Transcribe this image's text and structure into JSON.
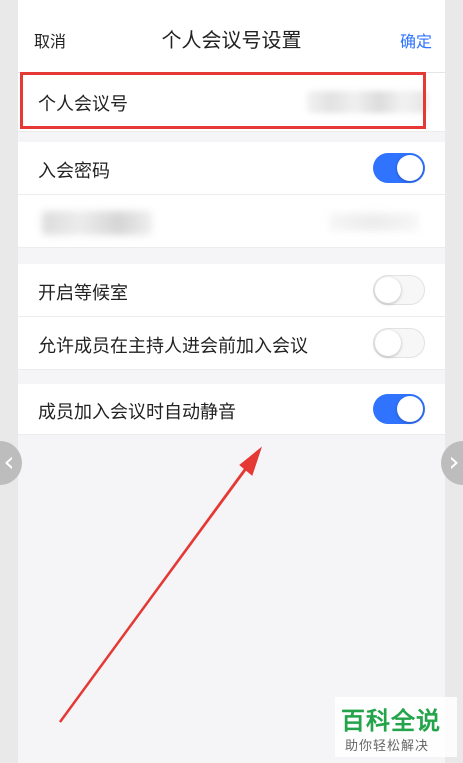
{
  "header": {
    "cancel_label": "取消",
    "title": "个人会议号设置",
    "confirm_label": "确定"
  },
  "rows": {
    "personal_meeting_id": {
      "label": "个人会议号"
    },
    "meeting_password": {
      "label": "入会密码",
      "enabled": true
    },
    "waiting_room": {
      "label": "开启等候室",
      "enabled": false
    },
    "join_before_host": {
      "label": "允许成员在主持人进会前加入会议",
      "enabled": false
    },
    "auto_mute": {
      "label": "成员加入会议时自动静音",
      "enabled": true
    }
  },
  "watermark": {
    "main": "百科全说",
    "sub": "助你轻松解决"
  },
  "colors": {
    "accent": "#2f73ff",
    "highlight": "#e53935",
    "arrow": "#e53935",
    "watermark": "#24a44a"
  },
  "nav": {
    "prev_icon": "chevron-left-icon",
    "next_icon": "chevron-right-icon"
  }
}
